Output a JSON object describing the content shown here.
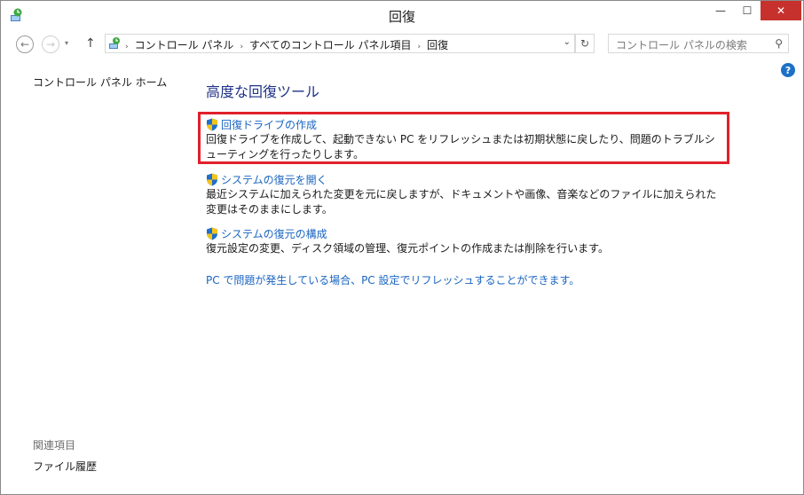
{
  "window": {
    "title": "回復",
    "controls": {
      "minimize": "—",
      "maximize": "☐",
      "close": "✕"
    }
  },
  "nav": {
    "back_icon": "←",
    "forward_icon": "→",
    "recent_icon": "▾",
    "up_icon": "↑",
    "breadcrumbs": [
      "コントロール パネル",
      "すべてのコントロール パネル項目",
      "回復"
    ],
    "separator": "›",
    "dropdown_icon": "⌄",
    "refresh_icon": "↻",
    "search_placeholder": "コントロール パネルの検索",
    "search_icon": "⚲"
  },
  "help_icon": "?",
  "sidebar": {
    "home_link": "コントロール パネル ホーム",
    "related_title": "関連項目",
    "related_links": [
      "ファイル履歴"
    ]
  },
  "main": {
    "heading": "高度な回復ツール",
    "items": [
      {
        "link": "回復ドライブの作成",
        "description": "回復ドライブを作成して、起動できない PC をリフレッシュまたは初期状態に戻したり、問題のトラブルシューティングを行ったりします。"
      },
      {
        "link": "システムの復元を開く",
        "description": "最近システムに加えられた変更を元に戻しますが、ドキュメントや画像、音楽などのファイルに加えられた変更はそのままにします。"
      },
      {
        "link": "システムの復元の構成",
        "description": "復元設定の変更、ディスク領域の管理、復元ポイントの作成または削除を行います。"
      }
    ],
    "pc_link": "PC で問題が発生している場合、PC 設定でリフレッシュすることができます。"
  },
  "colors": {
    "link": "#1964c0",
    "heading": "#1e3287",
    "highlight_border": "#e0202a",
    "close_button": "#c7312d"
  }
}
